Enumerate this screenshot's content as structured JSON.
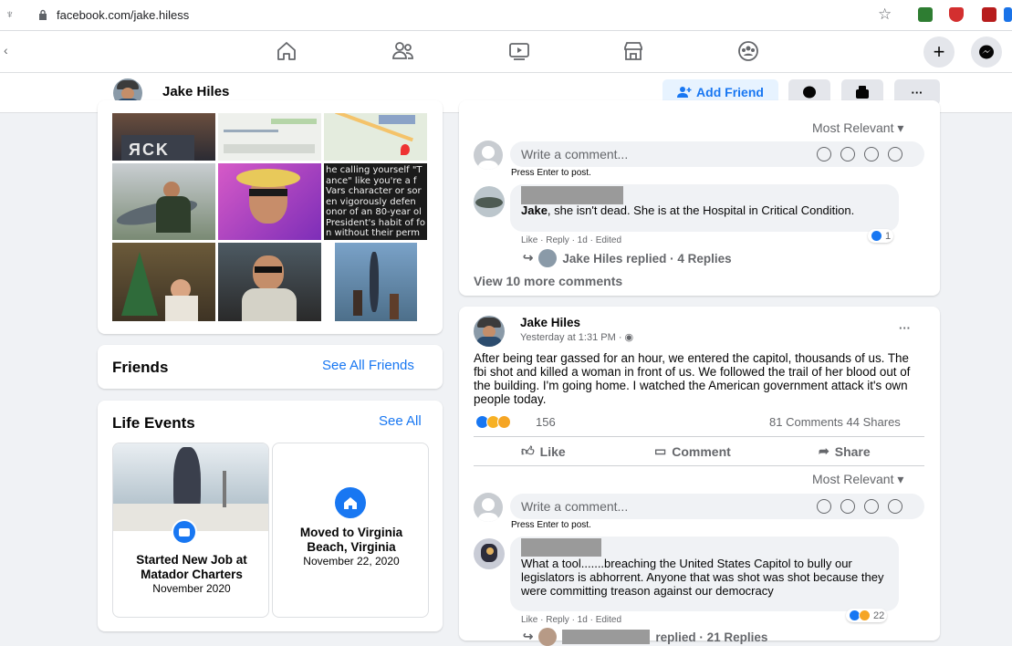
{
  "browser": {
    "url": "facebook.com/jake.hiless"
  },
  "profile": {
    "name": "Jake Hiles",
    "add_friend_label": "Add Friend",
    "more_label": "···"
  },
  "friends": {
    "title": "Friends",
    "see_all": "See All Friends"
  },
  "photo_overlay": {
    "text": [
      "he calling yourself \"T",
      "ance\" like you're a f",
      "Vars character or sor",
      "en vigorously defen",
      "onor of an 80-year ol",
      "President's habit of fo",
      "n without their perm"
    ]
  },
  "life_events": {
    "title": "Life Events",
    "see_all": "See All",
    "events": [
      {
        "title": "Started New Job at Matador Charters",
        "date": "November 2020"
      },
      {
        "title": "Moved to Virginia Beach, Virginia",
        "date": "November 22, 2020"
      }
    ]
  },
  "post1": {
    "most_relevant": "Most Relevant",
    "comment_placeholder": "Write a comment...",
    "press_enter": "Press Enter to post.",
    "comment": {
      "mention": "Jake",
      "text": ", she isn't dead. She is at the Hospital in Critical Condition.",
      "actions": "Like · Reply · 1d · Edited",
      "reactions": "1"
    },
    "replied": "Jake Hiles replied · 4 Replies",
    "view_more": "View 10 more comments"
  },
  "post2": {
    "author": "Jake Hiles",
    "time": "Yesterday at 1:31 PM · ",
    "more": "···",
    "text": "After being tear gassed for an hour, we entered the capitol, thousands of us.  The fbi shot and killed a woman in front of us. We followed the trail of her blood out of the building. I'm going home. I watched the American government attack it's own people today.",
    "reaction_count": "156",
    "comments_shares": "81 Comments 44 Shares",
    "like": "Like",
    "comment": "Comment",
    "share": "Share",
    "most_relevant": "Most Relevant",
    "comment_placeholder": "Write a comment...",
    "press_enter": "Press Enter to post.",
    "reply": {
      "text": "What a tool.......breaching the United States Capitol to bully our legislators is abhorrent. Anyone that was shot was shot because they were committing treason against our democracy",
      "actions": "Like · Reply · 1d · Edited",
      "reactions": "22"
    },
    "replied": "replied · 21 Replies"
  },
  "colors": {
    "accent": "#1877f2",
    "bg": "#f0f2f5"
  }
}
